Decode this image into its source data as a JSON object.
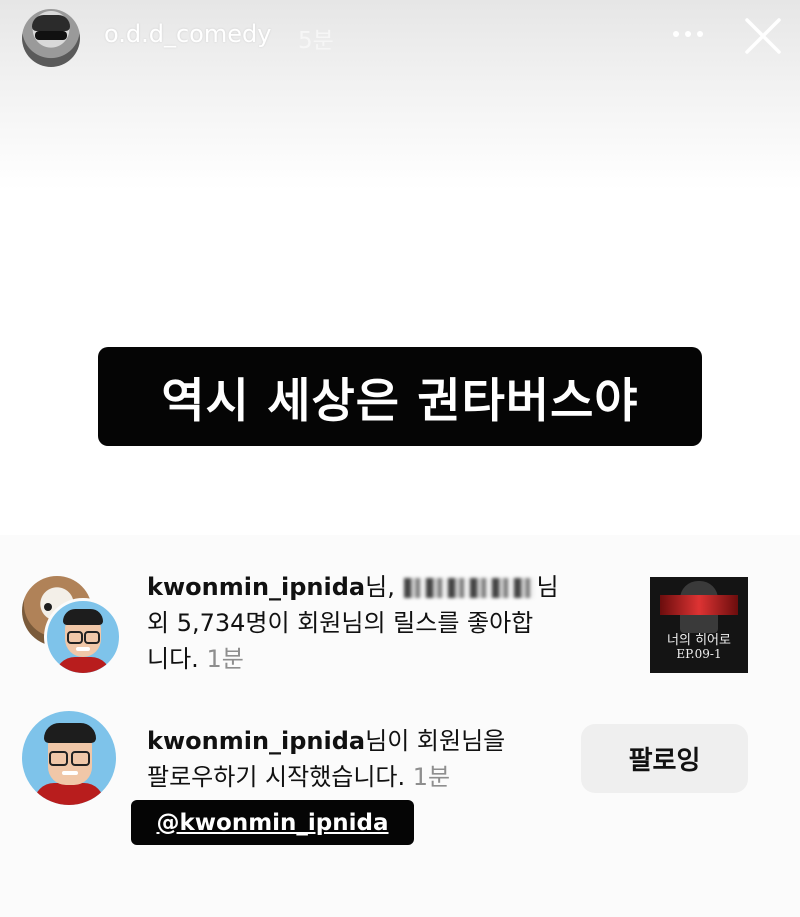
{
  "story": {
    "username": "o.d.d_comedy",
    "time": "5분",
    "more_icon": "more-dots-icon",
    "close_icon": "close-icon"
  },
  "caption": "역시 세상은 권타버스야",
  "notifications": [
    {
      "username": "kwonmin_ipnida",
      "line1_suffix": "님,",
      "line1_end": "님",
      "line2": "외 5,734명이 회원님의 릴스를 좋아합",
      "line3": "니다.",
      "time": "1분",
      "thumbnail": {
        "title": "너의 히어로",
        "episode": "EP.09-1"
      }
    },
    {
      "username": "kwonmin_ipnida",
      "line1_suffix": "님이 회원님을",
      "line2": "팔로우하기 시작했습니다.",
      "time": "1분",
      "button": "팔로잉"
    }
  ],
  "mention": "@kwonmin_ipnida"
}
